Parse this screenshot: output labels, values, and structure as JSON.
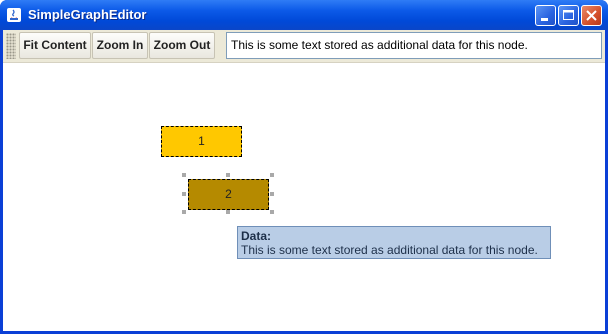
{
  "window": {
    "title": "SimpleGraphEditor",
    "buttons": [
      "minimize-icon",
      "maximize-icon",
      "close-icon"
    ]
  },
  "toolbar": {
    "fit_content_label": "Fit Content",
    "zoom_in_label": "Zoom In",
    "zoom_out_label": "Zoom Out",
    "data_field_value": "This is some text stored as additional data for this node."
  },
  "graph": {
    "nodes": [
      {
        "label": "1",
        "fill": "#ffc800",
        "selected": false
      },
      {
        "label": "2",
        "fill": "#b58a00",
        "selected": true
      }
    ]
  },
  "tooltip": {
    "title": "Data:",
    "body": "This is some text stored as additional data for this node."
  },
  "colors": {
    "titlebar": "#0c5ae8",
    "toolbar_bg": "#ece9d8",
    "tooltip_bg": "#b9cde6"
  }
}
